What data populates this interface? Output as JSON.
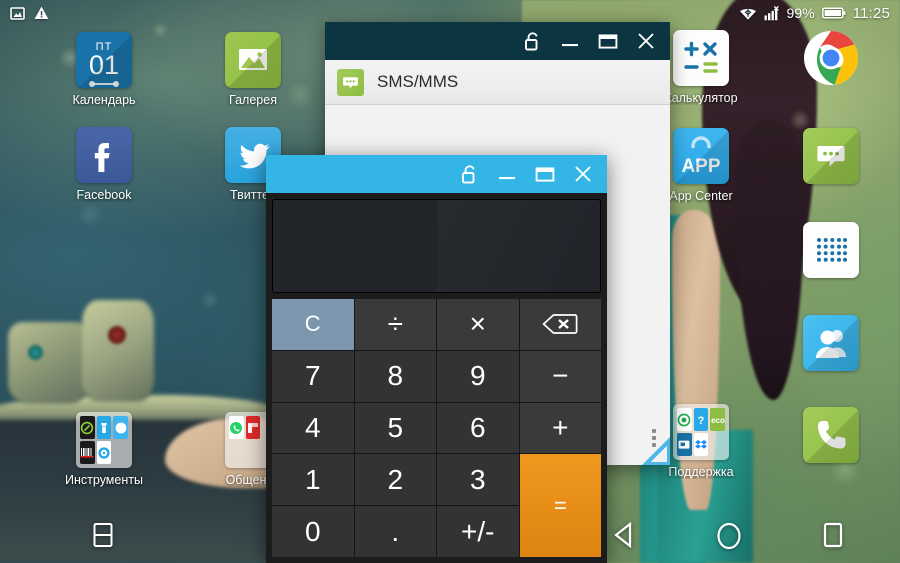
{
  "statusbar": {
    "left_icons": [
      "screenshot-icon",
      "warning-icon"
    ],
    "signal_icon": "bluetooth-wifi-icon",
    "cell_icon": "cell-signal-no-sim-icon",
    "battery_pct": "99%",
    "battery_icon": "battery-full-icon",
    "time": "11:25"
  },
  "desktop": {
    "icons": [
      {
        "name": "calendar",
        "label": "Календарь",
        "dow": "ПТ",
        "day": "01"
      },
      {
        "name": "gallery",
        "label": "Галерея"
      },
      {
        "name": "facebook",
        "label": "Facebook"
      },
      {
        "name": "twitter",
        "label": "Твиттер"
      },
      {
        "name": "tools",
        "label": "Инструменты"
      },
      {
        "name": "messaging",
        "label": "Общение"
      },
      {
        "name": "calculator",
        "label": "Калькулятор"
      },
      {
        "name": "chrome",
        "label": ""
      },
      {
        "name": "app-center",
        "label": "App Center"
      },
      {
        "name": "sms",
        "label": ""
      },
      {
        "name": "app-drawer",
        "label": ""
      },
      {
        "name": "contacts",
        "label": ""
      },
      {
        "name": "support",
        "label": "Поддержка"
      },
      {
        "name": "phone",
        "label": ""
      }
    ]
  },
  "windows": {
    "sms": {
      "app_title": "SMS/MMS",
      "titlebar_color": "#0b3540",
      "controls": [
        "unlock-icon",
        "minimize-icon",
        "maximize-icon",
        "close-icon"
      ],
      "overflow_label": "more-options"
    },
    "calculator": {
      "titlebar_color": "#33b5e5",
      "controls": [
        "unlock-icon",
        "minimize-icon",
        "maximize-icon",
        "close-icon"
      ],
      "display_value": "",
      "keys": [
        {
          "label": "C",
          "type": "clear",
          "name": "key-clear"
        },
        {
          "label": "÷",
          "type": "op",
          "name": "key-divide"
        },
        {
          "label": "×",
          "type": "op",
          "name": "key-multiply"
        },
        {
          "label": "⌫",
          "type": "backspace",
          "name": "key-backspace"
        },
        {
          "label": "7",
          "type": "num",
          "name": "key-7"
        },
        {
          "label": "8",
          "type": "num",
          "name": "key-8"
        },
        {
          "label": "9",
          "type": "num",
          "name": "key-9"
        },
        {
          "label": "−",
          "type": "op",
          "name": "key-minus"
        },
        {
          "label": "4",
          "type": "num",
          "name": "key-4"
        },
        {
          "label": "5",
          "type": "num",
          "name": "key-5"
        },
        {
          "label": "6",
          "type": "num",
          "name": "key-6"
        },
        {
          "label": "+",
          "type": "op",
          "name": "key-plus"
        },
        {
          "label": "1",
          "type": "num",
          "name": "key-1"
        },
        {
          "label": "2",
          "type": "num",
          "name": "key-2"
        },
        {
          "label": "3",
          "type": "num",
          "name": "key-3"
        },
        {
          "label": "=",
          "type": "equals",
          "name": "key-equals"
        },
        {
          "label": "0",
          "type": "num",
          "name": "key-0"
        },
        {
          "label": ".",
          "type": "num",
          "name": "key-decimal"
        },
        {
          "label": "+/-",
          "type": "num",
          "name": "key-sign"
        }
      ],
      "accent_equals": "#e8900f",
      "accent_clear": "#7b96ad"
    }
  },
  "navbar": {
    "split_screen": "split-screen-icon",
    "back": "back-icon",
    "home": "home-icon",
    "recents": "recents-icon"
  },
  "folders": {
    "tools_minis": [
      "compass-dark",
      "flashlight",
      "compass-blue",
      "barcode",
      "settings"
    ],
    "messaging_minis": [
      "whatsapp",
      "flipboard"
    ],
    "support_minis": [
      "recorder",
      "help",
      "eco",
      "remote",
      "dropbox"
    ]
  }
}
